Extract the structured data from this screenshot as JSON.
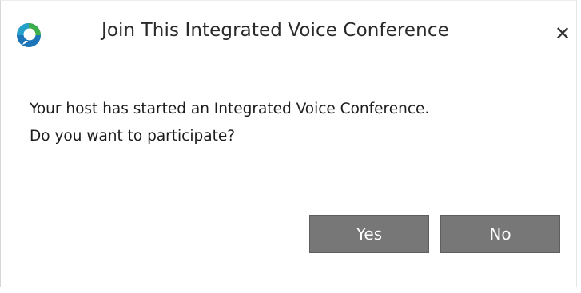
{
  "dialog": {
    "title": "Join This Integrated Voice Conference",
    "close_glyph": "✕",
    "app_icon": "app-logo-icon",
    "message_line1": "Your host has started an Integrated Voice Conference.",
    "message_line2": "Do you want to participate?",
    "yes_label": "Yes",
    "no_label": "No"
  },
  "colors": {
    "button_bg": "#777777",
    "icon_green": "#3cae4b",
    "icon_blue": "#1b75b8"
  }
}
